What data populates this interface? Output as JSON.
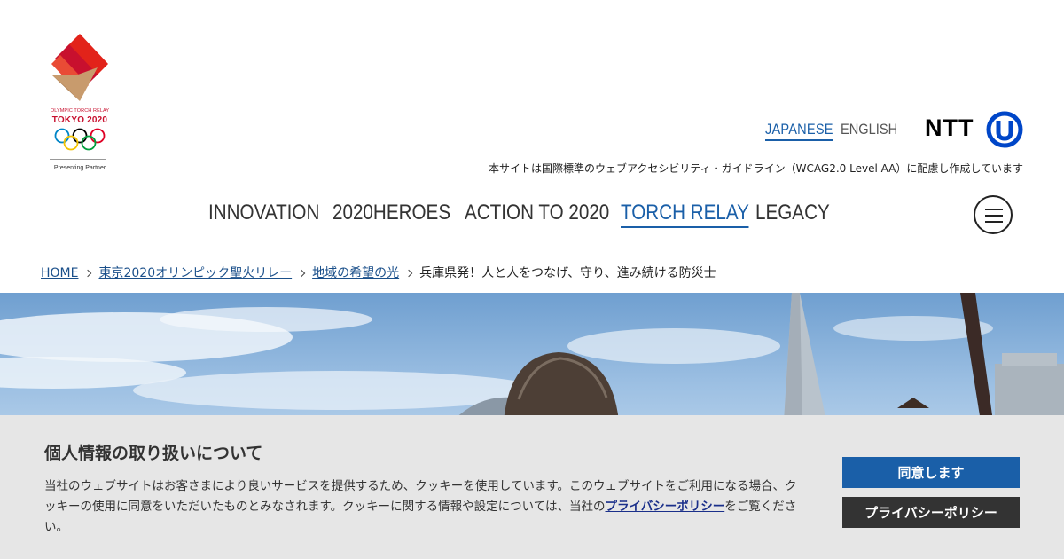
{
  "logo": {
    "caption_small": "OLYMPIC TORCH RELAY",
    "caption_large": "TOKYO 2020",
    "partner": "Presenting Partner"
  },
  "header": {
    "lang_japanese": "JAPANESE",
    "lang_english": "ENGLISH",
    "ntt": "NTT",
    "accessibility_note": "本サイトは国際標準のウェブアクセシビリティ・ガイドライン（WCAG2.0 Level AA）に配慮し作成しています"
  },
  "nav": {
    "items": [
      "INNOVATION",
      "2020HEROES",
      "ACTION TO 2020",
      "TORCH RELAY",
      "LEGACY"
    ],
    "active": "TORCH RELAY"
  },
  "breadcrumb": {
    "items": [
      "HOME",
      "東京2020オリンピック聖火リレー",
      "地域の希望の光"
    ],
    "current": "兵庫県発！人と人をつなげ、守り、進み続ける防災士"
  },
  "cookie": {
    "title": "個人情報の取り扱いについて",
    "body_before": "当社のウェブサイトはお客さまにより良いサービスを提供するため、クッキーを使用しています。このウェブサイトをご利用になる場合、クッキーの使用に同意をいただいたものとみなされます。クッキーに関する情報や設定については、当社の",
    "body_link": "プライバシーポリシー",
    "body_after": "をご覧ください。",
    "agree_button": "同意します",
    "policy_button": "プライバシーポリシー"
  },
  "colors": {
    "accent": "#1a5fa8",
    "ntt_blue": "#0046c8",
    "banner_bg": "#e6e6e6",
    "dark_button": "#333333"
  }
}
